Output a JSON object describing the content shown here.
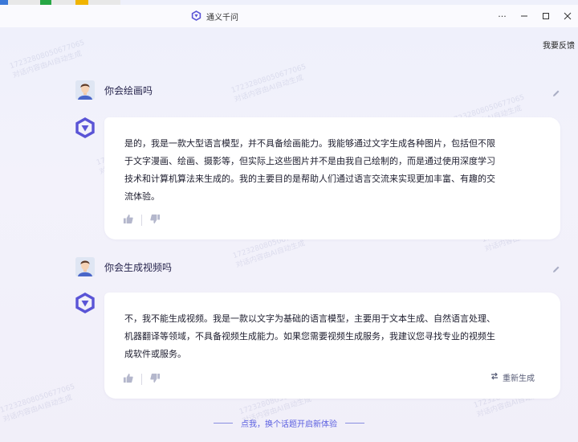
{
  "window": {
    "title": "通义千问",
    "controls": [
      "more-icon",
      "minimize-icon",
      "maximize-icon",
      "close-icon"
    ]
  },
  "header": {
    "feedback_label": "我要反馈"
  },
  "conversation": [
    {
      "role": "user",
      "text": "你会绘画吗"
    },
    {
      "role": "assistant",
      "lines": [
        "是的，我是一款大型语言模型，并不具备绘画能力。我能够通过文字生成各种图片，包括但不限",
        "于文字漫画、绘画、摄影等，但实际上这些图片并不是由我自己绘制的，而是通过使用深度学习",
        "技术和计算机算法来生成的。我的主要目的是帮助人们通过语言交流来实现更加丰富、有趣的交",
        "流体验。"
      ]
    },
    {
      "role": "user",
      "text": "你会生成视频吗"
    },
    {
      "role": "assistant",
      "lines": [
        "不，我不能生成视频。我是一款以文字为基础的语言模型，主要用于文本生成、自然语言处理、",
        "机器翻译等领域，不具备视频生成能力。如果您需要视频生成服务，我建议您寻找专业的视频生",
        "成软件或服务。"
      ],
      "regenerate_label": "重新生成"
    }
  ],
  "footer": {
    "new_topic_label": "点我，换个话题开启新体验"
  },
  "watermark": {
    "line1": "17232808050677065",
    "line2": "对话内容由AI自动生成"
  },
  "colors": {
    "accent": "#5b5fe0",
    "logo": "#5a54d6",
    "background": "#f1f0fa",
    "bubble": "#ffffff"
  }
}
